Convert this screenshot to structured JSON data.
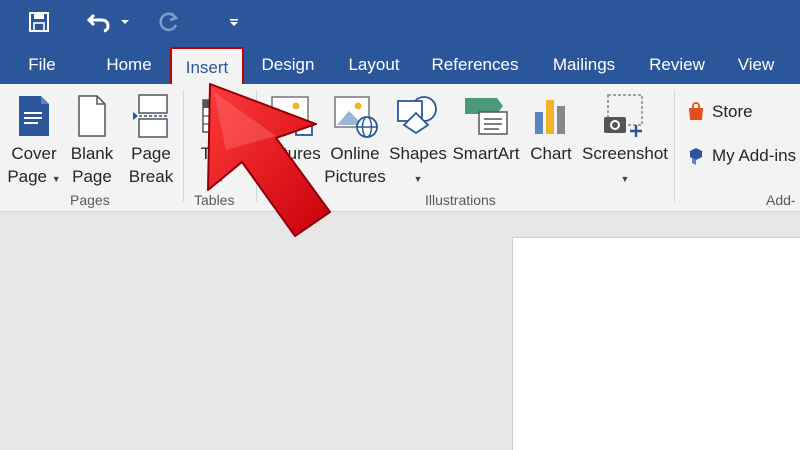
{
  "quick_access": {
    "save_icon": "save-icon",
    "undo_icon": "undo-icon",
    "redo_icon": "redo-icon",
    "customize_icon": "customize-qat-icon"
  },
  "tabs": [
    {
      "label": "File"
    },
    {
      "label": "Home"
    },
    {
      "label": "Insert",
      "active": true
    },
    {
      "label": "Design"
    },
    {
      "label": "Layout"
    },
    {
      "label": "References"
    },
    {
      "label": "Mailings"
    },
    {
      "label": "Review"
    },
    {
      "label": "View"
    }
  ],
  "ribbon": {
    "pages": {
      "group_label": "Pages",
      "cover_page": {
        "line1": "Cover",
        "line2": "Page"
      },
      "blank_page": {
        "line1": "Blank",
        "line2": "Page"
      },
      "page_break": {
        "line1": "Page",
        "line2": "Break"
      }
    },
    "tables": {
      "group_label": "Tables",
      "table": {
        "line1": "Table"
      }
    },
    "illustrations": {
      "group_label": "Illustrations",
      "pictures": {
        "line1": "Pictures"
      },
      "online_pictures": {
        "line1": "Online",
        "line2": "Pictures"
      },
      "shapes": {
        "line1": "Shapes"
      },
      "smartart": {
        "line1": "SmartArt"
      },
      "chart": {
        "line1": "Chart"
      },
      "screenshot": {
        "line1": "Screenshot"
      }
    },
    "addins": {
      "group_label": "Add-",
      "store": "Store",
      "my_addins": "My Add-ins"
    }
  },
  "colors": {
    "title_bar": "#2b579a",
    "ribbon_bg": "#f3f3f3",
    "highlight_border": "#c00000",
    "arrow_red": "#e8141b"
  }
}
